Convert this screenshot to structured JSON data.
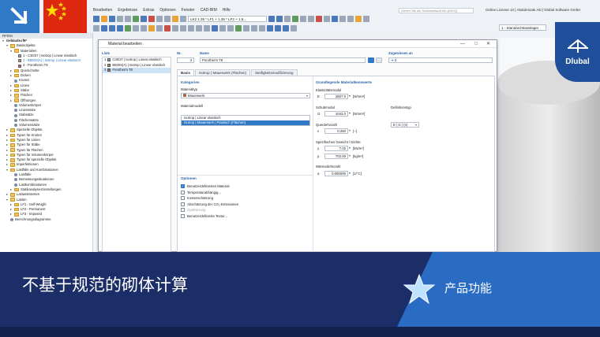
{
  "menu": [
    "Bearbeiten",
    "Ergebnisse",
    "Extras",
    "Optionen",
    "Fenster",
    "CAD-BIM",
    "Hilfe"
  ],
  "search_placeholder": "Geben Sie ein Schlüsselwort ein (Alt+Q)",
  "license": "Online License 10 | Abdulrrazak Aki | Dlubal Software GmbH",
  "load_combo": "LK2  1.35 * LF1 + 1.35 * LF2 + 1.5...",
  "view_combo": "1 - Standard-Basislager",
  "navigator": {
    "header": "RFEM",
    "items": [
      {
        "indent": 0,
        "tw": "▾",
        "label": "Gebäude.rf6*",
        "type": "none",
        "bold": true
      },
      {
        "indent": 1,
        "tw": "▾",
        "label": "Basisobjekte",
        "type": "folder"
      },
      {
        "indent": 2,
        "tw": "▾",
        "label": "Materialien",
        "type": "folder"
      },
      {
        "indent": 3,
        "tw": "",
        "label": "1 - C30/37 | Isotrop | Linear elastisch",
        "type": "swatch",
        "color": "#8e9fbf"
      },
      {
        "indent": 3,
        "tw": "",
        "label": "2 - B500S(A) | Isotrop | Linear elastisch",
        "type": "swatch",
        "color": "#c98a3a",
        "hl": true
      },
      {
        "indent": 3,
        "tw": "",
        "label": "3 - Porotherm T8",
        "type": "swatch",
        "color": "#b06a4a"
      },
      {
        "indent": 2,
        "tw": "▸",
        "label": "Querschnitte",
        "type": "folder"
      },
      {
        "indent": 2,
        "tw": "▸",
        "label": "Dicken",
        "type": "folder"
      },
      {
        "indent": 2,
        "tw": "",
        "label": "Knoten",
        "type": "dot"
      },
      {
        "indent": 2,
        "tw": "▸",
        "label": "Linien",
        "type": "folder"
      },
      {
        "indent": 2,
        "tw": "▸",
        "label": "Stäbe",
        "type": "folder"
      },
      {
        "indent": 2,
        "tw": "▸",
        "label": "Flächen",
        "type": "folder"
      },
      {
        "indent": 2,
        "tw": "▸",
        "label": "Öffnungen",
        "type": "folder"
      },
      {
        "indent": 2,
        "tw": "",
        "label": "Volumenkörper",
        "type": "dot"
      },
      {
        "indent": 2,
        "tw": "",
        "label": "Liniensätze",
        "type": "dot"
      },
      {
        "indent": 2,
        "tw": "",
        "label": "Stabsätze",
        "type": "dot"
      },
      {
        "indent": 2,
        "tw": "",
        "label": "Flächensätze",
        "type": "dot"
      },
      {
        "indent": 2,
        "tw": "",
        "label": "Volumensätze",
        "type": "dot"
      },
      {
        "indent": 1,
        "tw": "▸",
        "label": "Spezielle Objekte",
        "type": "folder"
      },
      {
        "indent": 1,
        "tw": "▸",
        "label": "Typen für Knoten",
        "type": "folder"
      },
      {
        "indent": 1,
        "tw": "▸",
        "label": "Typen für Linien",
        "type": "folder"
      },
      {
        "indent": 1,
        "tw": "▸",
        "label": "Typen für Stäbe",
        "type": "folder"
      },
      {
        "indent": 1,
        "tw": "▸",
        "label": "Typen für Flächen",
        "type": "folder"
      },
      {
        "indent": 1,
        "tw": "▸",
        "label": "Typen für Volumenkörper",
        "type": "folder"
      },
      {
        "indent": 1,
        "tw": "▸",
        "label": "Typen für spezielle Objekte",
        "type": "folder"
      },
      {
        "indent": 1,
        "tw": "▸",
        "label": "Imperfektionen",
        "type": "folder"
      },
      {
        "indent": 1,
        "tw": "▾",
        "label": "Lastfälle und Kombinationen",
        "type": "folder"
      },
      {
        "indent": 2,
        "tw": "",
        "label": "Lastfälle",
        "type": "dot"
      },
      {
        "indent": 2,
        "tw": "",
        "label": "Bemessungssituationen",
        "type": "dot"
      },
      {
        "indent": 2,
        "tw": "",
        "label": "Lastkombinationen",
        "type": "dot"
      },
      {
        "indent": 2,
        "tw": "▸",
        "label": "Statikanalyse-Einstellungen",
        "type": "folder"
      },
      {
        "indent": 1,
        "tw": "▸",
        "label": "Lastassistenten",
        "type": "folder"
      },
      {
        "indent": 1,
        "tw": "▾",
        "label": "Lasten",
        "type": "folder"
      },
      {
        "indent": 2,
        "tw": "▸",
        "label": "LF1 - Self-Weight",
        "type": "folder"
      },
      {
        "indent": 2,
        "tw": "▸",
        "label": "LF2 - Permanent",
        "type": "folder"
      },
      {
        "indent": 2,
        "tw": "▸",
        "label": "LF3 - Imposed",
        "type": "folder"
      },
      {
        "indent": 1,
        "tw": "",
        "label": "Berechnungsdiagramme",
        "type": "dot"
      }
    ]
  },
  "dialog": {
    "title": "Material bearbeiten",
    "list_label": "Liste",
    "list": [
      {
        "no": "1",
        "name": "C30/37 | Isotrop | Linear elastisch",
        "color": "#8e9fbf"
      },
      {
        "no": "2",
        "name": "B500S(A) | Isotrop | Linear elastisch",
        "color": "#c98a3a"
      },
      {
        "no": "3",
        "name": "Porotherm T8",
        "color": "#b06a4a",
        "selected": true
      }
    ],
    "no_label": "Nr.",
    "no_value": "3",
    "name_label": "Name",
    "name_value": "Porotherm T8",
    "assigned_label": "Zugewiesen an",
    "assigned_value": "3",
    "tabs": [
      "Basis",
      "Isotrop | Mauerwerk (Flächen)",
      "Steifigkeitsmodifizierung"
    ],
    "kategorien": "Kategorien",
    "materialtyp_label": "Materialtyp",
    "materialtyp_value": "Mauerwerk",
    "materialmodell_label": "Materialmodell",
    "materialmodell_value": "Isotrop | Mauerwerk | Plastisch (Flächen)",
    "model_options": [
      "Isotrop | Linear elastisch",
      "Isotrop | Mauerwerk | Plastisch (Flächen)"
    ],
    "grund_title": "Grundlegende Materialkennwerte",
    "e_label": "Elastizitätsmodul",
    "e_sym": "E",
    "e_val": "2607.0",
    "e_unit": "[N/mm²]",
    "g_label": "Schubmodul",
    "g_sym": "G",
    "g_val": "1043.0",
    "g_unit": "[N/mm²]",
    "def_label": "Definitionstyp",
    "def_value": "E | G | (n)",
    "nu_label": "Querdehnzahl",
    "nu_sym": "ν",
    "nu_val": "0.250",
    "nu_unit": "[--]",
    "gamma_label": "Spezifisches Gewicht / Dichte",
    "gamma_sym": "γ",
    "gamma_val": "7.02",
    "gamma_unit": "[kN/m³]",
    "rho_sym": "ρ",
    "rho_val": "702.00",
    "rho_unit": "[kg/m³]",
    "alpha_label": "Wärmedehnzahl",
    "alpha_sym": "α",
    "alpha_val": "0.000000",
    "alpha_unit": "[1/°C]",
    "options_title": "Optionen",
    "options": [
      {
        "label": "Benutzerdefiniertes Material",
        "checked": true
      },
      {
        "label": "Temperaturabhängig...",
        "checked": false
      },
      {
        "label": "Kostenschätzung",
        "checked": false
      },
      {
        "label": "Abschätzung der CO₂-Emissionen",
        "checked": false
      },
      {
        "label": "Optimierung",
        "checked": false,
        "disabled": true
      },
      {
        "label": "Benutzerdefinierte Textur...",
        "checked": false
      }
    ]
  },
  "bottom_title": "不基于规范的砌体计算",
  "feature_label": "产品功能",
  "logo_text": "Dlubal"
}
